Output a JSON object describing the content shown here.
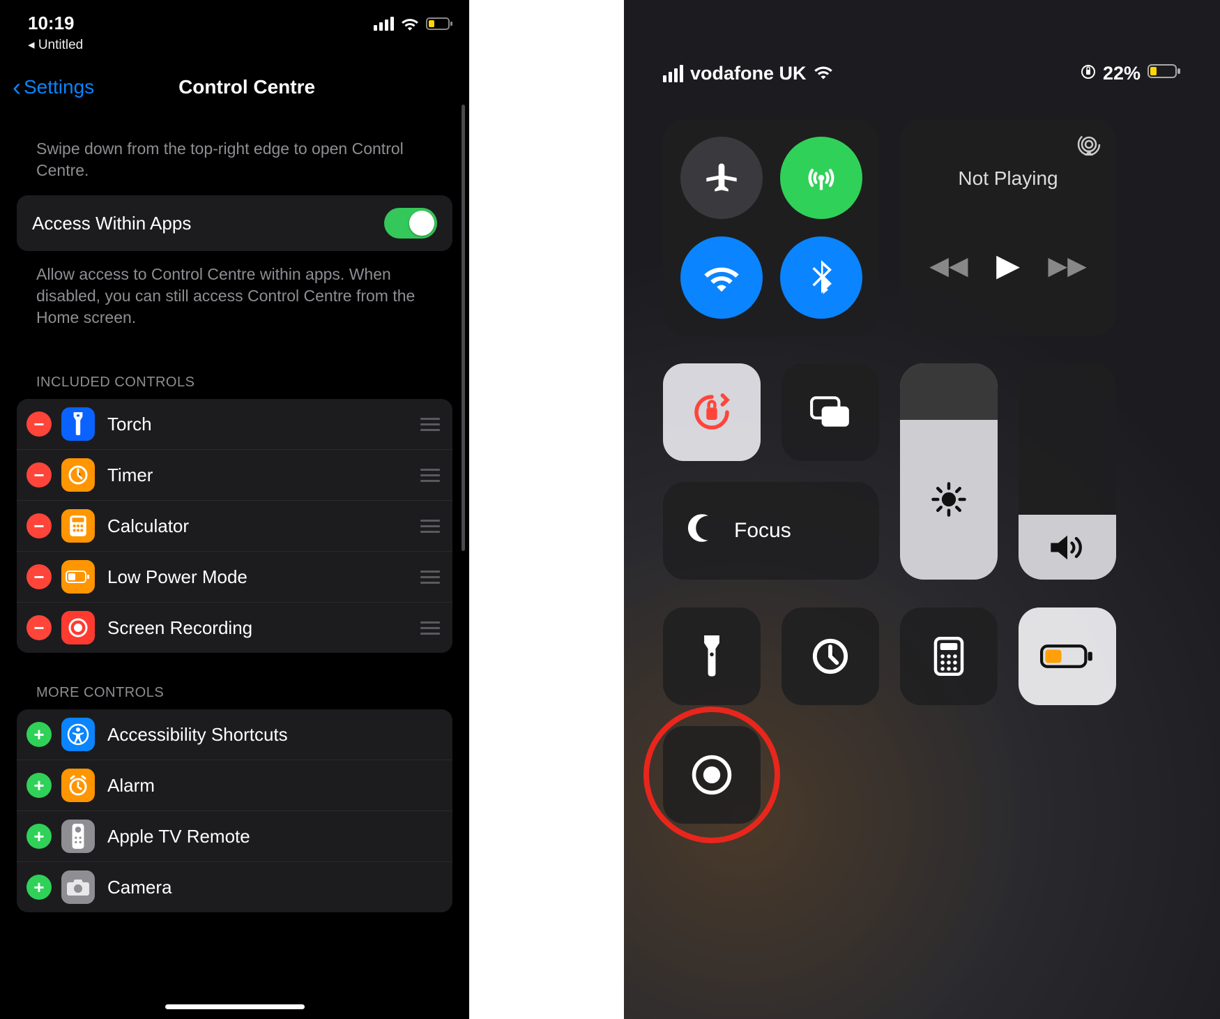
{
  "left": {
    "status": {
      "time": "10:19",
      "back_app": "◂ Untitled"
    },
    "nav": {
      "back": "Settings",
      "title": "Control Centre"
    },
    "hint1": "Swipe down from the top-right edge to open Control Centre.",
    "access": {
      "label": "Access Within Apps"
    },
    "hint2": "Allow access to Control Centre within apps. When disabled, you can still access Control Centre from the Home screen.",
    "included_header": "INCLUDED CONTROLS",
    "included": [
      {
        "label": "Torch",
        "icon_bg": "#0a62ff"
      },
      {
        "label": "Timer",
        "icon_bg": "#ff9500"
      },
      {
        "label": "Calculator",
        "icon_bg": "#ff9500"
      },
      {
        "label": "Low Power Mode",
        "icon_bg": "#ff9500"
      },
      {
        "label": "Screen Recording",
        "icon_bg": "#ff3b30"
      }
    ],
    "more_header": "MORE CONTROLS",
    "more": [
      {
        "label": "Accessibility Shortcuts",
        "icon_bg": "#0a84ff"
      },
      {
        "label": "Alarm",
        "icon_bg": "#ff9500"
      },
      {
        "label": "Apple TV Remote",
        "icon_bg": "#8e8e93"
      },
      {
        "label": "Camera",
        "icon_bg": "#8e8e93"
      }
    ]
  },
  "right": {
    "carrier": "vodafone UK",
    "battery_pct": "22%",
    "media_title": "Not Playing",
    "focus_label": "Focus"
  }
}
